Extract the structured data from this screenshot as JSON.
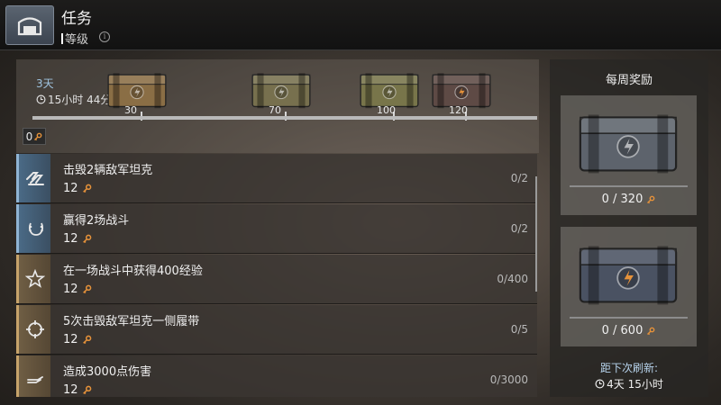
{
  "header": {
    "title": "任务",
    "subtitle": "等级"
  },
  "progress": {
    "days_left": "3天",
    "time_left": "15小时 44分",
    "current_keys": "0",
    "max_value": 120,
    "milestones": [
      {
        "value": 30,
        "label": "30",
        "chest_color": "#8a6e45"
      },
      {
        "value": 70,
        "label": "70",
        "chest_color": "#77704e"
      },
      {
        "value": 100,
        "label": "100",
        "chest_color": "#78754a"
      },
      {
        "value": 120,
        "label": "120",
        "chest_color": "#5e4a45"
      }
    ]
  },
  "tasks": [
    {
      "icon": "tank-icon",
      "name": "击毁2辆敌军坦克",
      "reward": "12",
      "count": "0/2",
      "accent": "blue"
    },
    {
      "icon": "laurel-icon",
      "name": "赢得2场战斗",
      "reward": "12",
      "count": "0/2",
      "accent": "blue"
    },
    {
      "icon": "star-icon",
      "name": "在一场战斗中获得400经验",
      "reward": "12",
      "count": "0/400",
      "accent": "gold"
    },
    {
      "icon": "crosshair-icon",
      "name": "5次击毁敌军坦克一侧履带",
      "reward": "12",
      "count": "0/5",
      "accent": "gold"
    },
    {
      "icon": "shell-icon",
      "name": "造成3000点伤害",
      "reward": "12",
      "count": "0/3000",
      "accent": "gold"
    }
  ],
  "weekly": {
    "title": "每周奖励",
    "rewards": [
      {
        "progress": "0 / 320",
        "chest_color": "#5d636c"
      },
      {
        "progress": "0 / 600",
        "chest_color": "#4a5262"
      }
    ],
    "refresh_label": "距下次刷新:",
    "refresh_time": "4天 15小时"
  },
  "colors": {
    "key": "#e6923a",
    "accent_blue": "#8fb4d4",
    "accent_gold": "#c7a36a"
  }
}
